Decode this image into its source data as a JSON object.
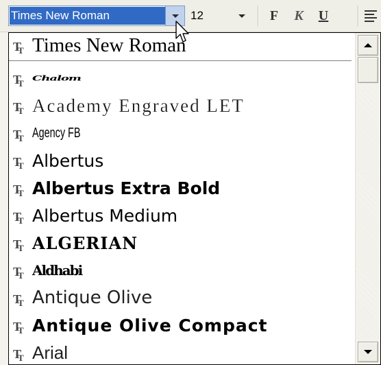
{
  "toolbar": {
    "font_value": "Times New Roman",
    "size_value": "12",
    "bold_label": "F",
    "italic_label": "K",
    "underline_label": "U"
  },
  "dropdown": {
    "recent_fonts": [
      "Times New Roman"
    ],
    "fonts": [
      "Chalom",
      "Academy Engraved LET",
      "Agency FB",
      "Albertus",
      "Albertus Extra Bold",
      "Albertus Medium",
      "ALGERIAN",
      "Aldhabi",
      "Antique Olive",
      "Antique Olive Compact",
      "Arial"
    ]
  },
  "icons": {
    "font_type": "truetype-font-icon",
    "combo_arrow": "chevron-down-icon",
    "scroll_up": "scroll-up-arrow-icon",
    "scroll_down": "scroll-down-arrow-icon",
    "align": "align-left-icon",
    "cursor": "mouse-pointer-icon"
  },
  "colors": {
    "selection": "#316ac5",
    "combo_button": "#c1d2ee",
    "toolbar_bg": "#efeee7"
  }
}
